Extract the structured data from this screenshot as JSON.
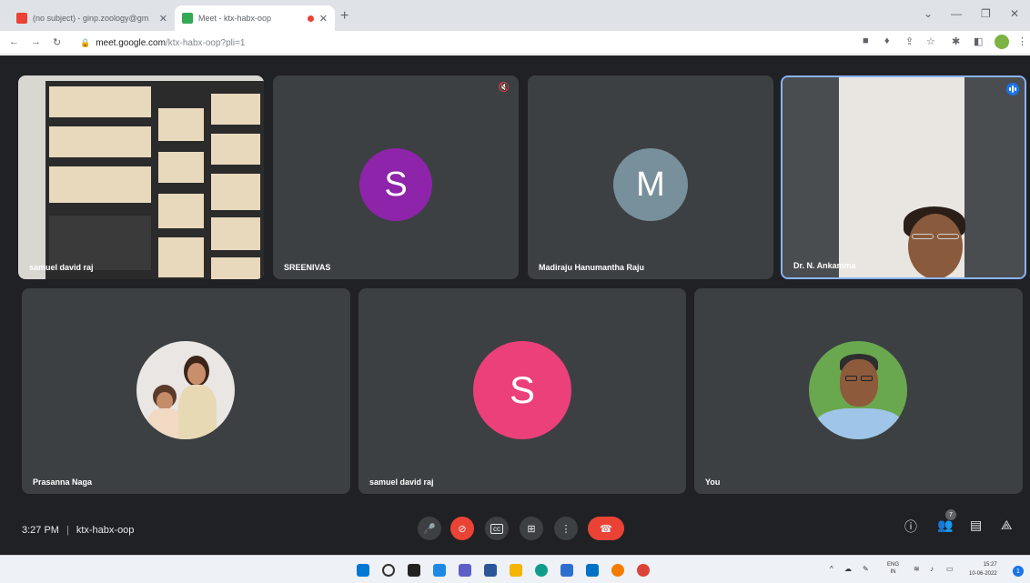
{
  "browser": {
    "tabs": [
      {
        "title": "(no subject) - ginp.zoology@gm",
        "active": false
      },
      {
        "title": "Meet - ktx-habx-oop",
        "active": true
      }
    ],
    "url_domain": "meet.google.com",
    "url_path": "/ktx-habx-oop?pli=1"
  },
  "meet": {
    "time": "3:27 PM",
    "meeting_code": "ktx-habx-oop",
    "participant_count": "7",
    "tiles": [
      {
        "name": "samuel david raj",
        "kind": "video-bookshelf"
      },
      {
        "name": "SREENIVAS",
        "kind": "avatar",
        "initial": "S",
        "color": "#8e24aa",
        "muted": true
      },
      {
        "name": "Madiraju Hanumantha Raju",
        "kind": "avatar",
        "initial": "M",
        "color": "#78909c"
      },
      {
        "name": "Dr. N. Ankamma",
        "kind": "video-speaker",
        "speaking": true
      },
      {
        "name": "Prasanna Naga",
        "kind": "photo"
      },
      {
        "name": "samuel david raj",
        "kind": "avatar",
        "initial": "S",
        "color": "#ec407a"
      },
      {
        "name": "You",
        "kind": "photo"
      }
    ],
    "controls": [
      {
        "name": "mic-icon"
      },
      {
        "name": "camera-off-icon"
      },
      {
        "name": "captions-icon"
      },
      {
        "name": "present-icon"
      },
      {
        "name": "more-options-icon"
      },
      {
        "name": "leave-call-icon"
      }
    ],
    "side_controls": [
      {
        "name": "info-icon",
        "glyph": "ⓘ"
      },
      {
        "name": "people-icon",
        "glyph": "👥"
      },
      {
        "name": "chat-icon",
        "glyph": "▤"
      },
      {
        "name": "activities-icon",
        "glyph": "⟁"
      }
    ]
  },
  "taskbar": {
    "lang_top": "ENG",
    "lang_bottom": "IN",
    "time": "15:27",
    "date": "10-06-2022",
    "notifications": "1"
  },
  "colors": {
    "stage_bg": "#202124",
    "tile_bg": "#3c4043",
    "leave_red": "#ea4335",
    "active_border": "#8ab4f8"
  }
}
